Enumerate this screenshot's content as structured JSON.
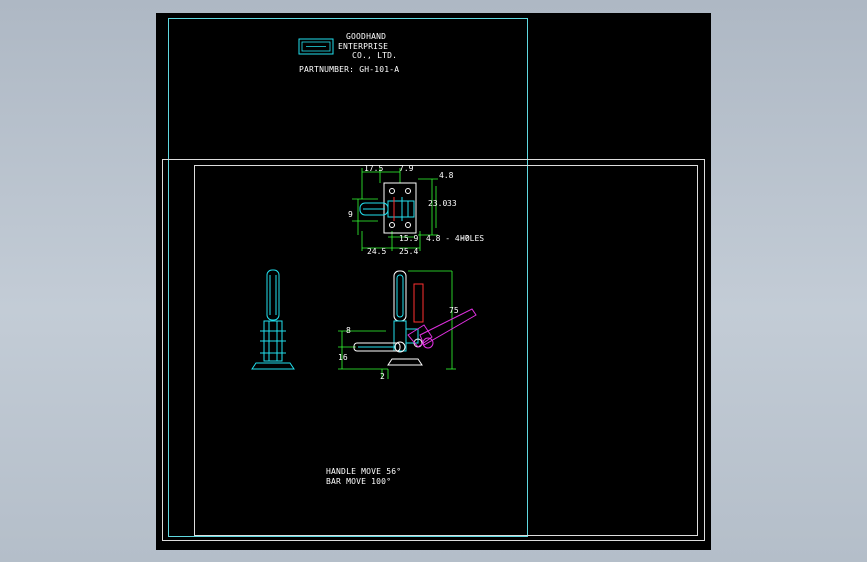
{
  "title_block": {
    "company_line1": "GOODHAND",
    "company_line2": "ENTERPRISE",
    "company_line3": "CO., LTD.",
    "part_number": "PARTNUMBER: GH-101-A"
  },
  "notes": {
    "handle_move": "HANDLE MOVE 56°",
    "bar_move": "BAR MOVE 100°"
  },
  "dimensions": {
    "top_view": {
      "d1": "17.5",
      "d2": "7.9",
      "d3": "4.8",
      "d4": "23.0",
      "d5": "33",
      "d6": "9",
      "d7": "15.9",
      "d8": "4.8 - 4-?",
      "d9": "HOLES",
      "d10": "24.5",
      "d11": "25.4"
    },
    "side_view": {
      "d1": "75",
      "d2": "8",
      "d3": "16",
      "d4": "2"
    }
  },
  "colors": {
    "background": "#000000",
    "frame_cyan": "#5fd8e0",
    "frame_white": "#ffffff",
    "dimension_green": "#33ff33",
    "part_cyan": "#22e0ee",
    "part_magenta": "#e030e0",
    "part_red": "#ff3030",
    "text_white": "#ffffff"
  }
}
